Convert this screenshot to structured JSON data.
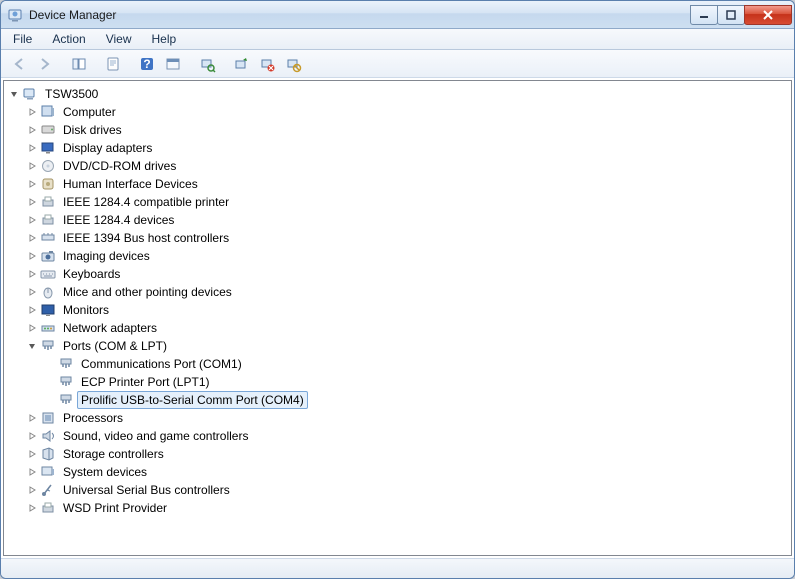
{
  "window": {
    "title": "Device Manager"
  },
  "menu": {
    "file": "File",
    "action": "Action",
    "view": "View",
    "help": "Help"
  },
  "toolbar_icons": {
    "back": "back-icon",
    "forward": "forward-icon",
    "show_hide": "show-hide-tree-icon",
    "properties": "properties-icon",
    "help": "help-icon",
    "options": "options-icon",
    "scan": "scan-hardware-icon",
    "update_driver": "update-driver-icon",
    "uninstall": "uninstall-icon",
    "disable": "disable-icon"
  },
  "root": {
    "label": "TSW3500"
  },
  "categories": [
    {
      "label": "Computer",
      "icon": "computer"
    },
    {
      "label": "Disk drives",
      "icon": "disk"
    },
    {
      "label": "Display adapters",
      "icon": "display"
    },
    {
      "label": "DVD/CD-ROM drives",
      "icon": "dvd"
    },
    {
      "label": "Human Interface Devices",
      "icon": "hid"
    },
    {
      "label": "IEEE 1284.4 compatible printer",
      "icon": "printer"
    },
    {
      "label": "IEEE 1284.4 devices",
      "icon": "printer"
    },
    {
      "label": "IEEE 1394 Bus host controllers",
      "icon": "bus"
    },
    {
      "label": "Imaging devices",
      "icon": "camera"
    },
    {
      "label": "Keyboards",
      "icon": "keyboard"
    },
    {
      "label": "Mice and other pointing devices",
      "icon": "mouse"
    },
    {
      "label": "Monitors",
      "icon": "monitor"
    },
    {
      "label": "Network adapters",
      "icon": "network"
    },
    {
      "label": "Ports (COM & LPT)",
      "icon": "port",
      "expanded": true,
      "children": [
        {
          "label": "Communications Port (COM1)",
          "icon": "port"
        },
        {
          "label": "ECP Printer Port (LPT1)",
          "icon": "port"
        },
        {
          "label": "Prolific USB-to-Serial Comm Port (COM4)",
          "icon": "port",
          "selected": true
        }
      ]
    },
    {
      "label": "Processors",
      "icon": "cpu"
    },
    {
      "label": "Sound, video and game controllers",
      "icon": "sound"
    },
    {
      "label": "Storage controllers",
      "icon": "storage"
    },
    {
      "label": "System devices",
      "icon": "system"
    },
    {
      "label": "Universal Serial Bus controllers",
      "icon": "usb"
    },
    {
      "label": "WSD Print Provider",
      "icon": "printer"
    }
  ]
}
